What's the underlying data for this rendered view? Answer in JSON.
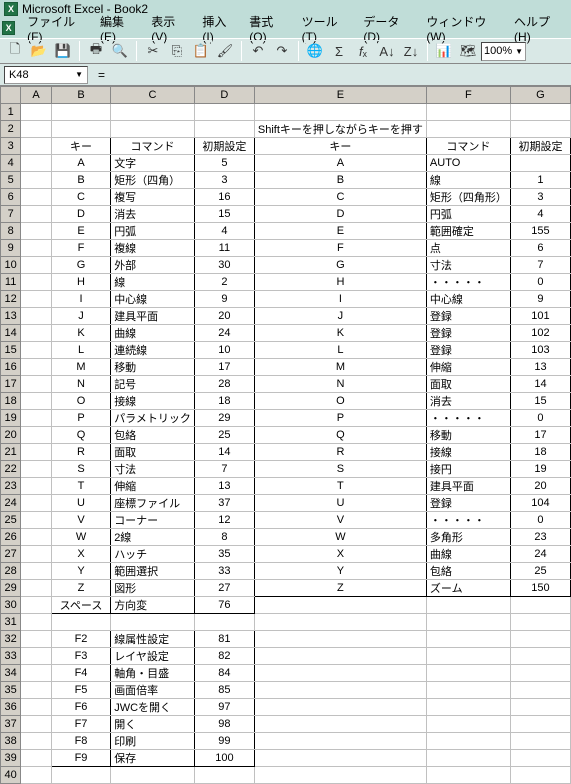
{
  "app": {
    "title": "Microsoft Excel - Book2"
  },
  "menu": {
    "file": "ファイル(F)",
    "edit": "編集(E)",
    "view": "表示(V)",
    "insert": "挿入(I)",
    "format": "書式(O)",
    "tool": "ツール(T)",
    "data": "データ(D)",
    "window": "ウィンドウ(W)",
    "help": "ヘルプ(H)"
  },
  "toolbar": {
    "zoom": "100%"
  },
  "namebox": {
    "ref": "K48"
  },
  "cols": [
    "A",
    "B",
    "C",
    "D",
    "E",
    "F",
    "G"
  ],
  "note": "Shiftキーを押しながらキーを押す",
  "headers": {
    "key": "キー",
    "cmd": "コマンド",
    "init": "初期設定"
  },
  "left": [
    {
      "k": "A",
      "c": "文字",
      "v": "5"
    },
    {
      "k": "B",
      "c": "矩形（四角）",
      "v": "3"
    },
    {
      "k": "C",
      "c": "複写",
      "v": "16"
    },
    {
      "k": "D",
      "c": "消去",
      "v": "15"
    },
    {
      "k": "E",
      "c": "円弧",
      "v": "4"
    },
    {
      "k": "F",
      "c": "複線",
      "v": "11"
    },
    {
      "k": "G",
      "c": "外部",
      "v": "30"
    },
    {
      "k": "H",
      "c": "線",
      "v": "2"
    },
    {
      "k": "I",
      "c": "中心線",
      "v": "9"
    },
    {
      "k": "J",
      "c": "建具平面",
      "v": "20"
    },
    {
      "k": "K",
      "c": "曲線",
      "v": "24"
    },
    {
      "k": "L",
      "c": "連続線",
      "v": "10"
    },
    {
      "k": "M",
      "c": "移動",
      "v": "17"
    },
    {
      "k": "N",
      "c": "記号",
      "v": "28"
    },
    {
      "k": "O",
      "c": "接線",
      "v": "18"
    },
    {
      "k": "P",
      "c": "パラメトリック",
      "v": "29"
    },
    {
      "k": "Q",
      "c": "包絡",
      "v": "25"
    },
    {
      "k": "R",
      "c": "面取",
      "v": "14"
    },
    {
      "k": "S",
      "c": "寸法",
      "v": "7"
    },
    {
      "k": "T",
      "c": "伸縮",
      "v": "13"
    },
    {
      "k": "U",
      "c": "座標ファイル",
      "v": "37"
    },
    {
      "k": "V",
      "c": "コーナー",
      "v": "12"
    },
    {
      "k": "W",
      "c": "2線",
      "v": "8"
    },
    {
      "k": "X",
      "c": "ハッチ",
      "v": "35"
    },
    {
      "k": "Y",
      "c": "範囲選択",
      "v": "33"
    },
    {
      "k": "Z",
      "c": "図形",
      "v": "27"
    },
    {
      "k": "スペース",
      "c": "方向変",
      "v": "76"
    }
  ],
  "leftF": [
    {
      "k": "F2",
      "c": "線属性設定",
      "v": "81"
    },
    {
      "k": "F3",
      "c": "レイヤ設定",
      "v": "82"
    },
    {
      "k": "F4",
      "c": "軸角・目盛",
      "v": "84"
    },
    {
      "k": "F5",
      "c": "画面倍率",
      "v": "85"
    },
    {
      "k": "F6",
      "c": "JWCを開く",
      "v": "97"
    },
    {
      "k": "F7",
      "c": "開く",
      "v": "98"
    },
    {
      "k": "F8",
      "c": "印刷",
      "v": "99"
    },
    {
      "k": "F9",
      "c": "保存",
      "v": "100"
    }
  ],
  "right": [
    {
      "k": "A",
      "c": "AUTO",
      "v": ""
    },
    {
      "k": "B",
      "c": "線",
      "v": "1"
    },
    {
      "k": "C",
      "c": "矩形（四角形）",
      "v": "3"
    },
    {
      "k": "D",
      "c": "円弧",
      "v": "4"
    },
    {
      "k": "E",
      "c": "範囲確定",
      "v": "155"
    },
    {
      "k": "F",
      "c": "点",
      "v": "6"
    },
    {
      "k": "G",
      "c": "寸法",
      "v": "7"
    },
    {
      "k": "H",
      "c": "・・・・・",
      "v": "0"
    },
    {
      "k": "I",
      "c": "中心線",
      "v": "9"
    },
    {
      "k": "J",
      "c": "登録",
      "v": "101"
    },
    {
      "k": "K",
      "c": "登録",
      "v": "102"
    },
    {
      "k": "L",
      "c": "登録",
      "v": "103"
    },
    {
      "k": "M",
      "c": "伸縮",
      "v": "13"
    },
    {
      "k": "N",
      "c": "面取",
      "v": "14"
    },
    {
      "k": "O",
      "c": "消去",
      "v": "15"
    },
    {
      "k": "P",
      "c": "・・・・・",
      "v": "0"
    },
    {
      "k": "Q",
      "c": "移動",
      "v": "17"
    },
    {
      "k": "R",
      "c": "接線",
      "v": "18"
    },
    {
      "k": "S",
      "c": "接円",
      "v": "19"
    },
    {
      "k": "T",
      "c": "建具平面",
      "v": "20"
    },
    {
      "k": "U",
      "c": "登録",
      "v": "104"
    },
    {
      "k": "V",
      "c": "・・・・・",
      "v": "0"
    },
    {
      "k": "W",
      "c": "多角形",
      "v": "23"
    },
    {
      "k": "X",
      "c": "曲線",
      "v": "24"
    },
    {
      "k": "Y",
      "c": "包絡",
      "v": "25"
    },
    {
      "k": "Z",
      "c": "ズーム",
      "v": "150"
    }
  ]
}
